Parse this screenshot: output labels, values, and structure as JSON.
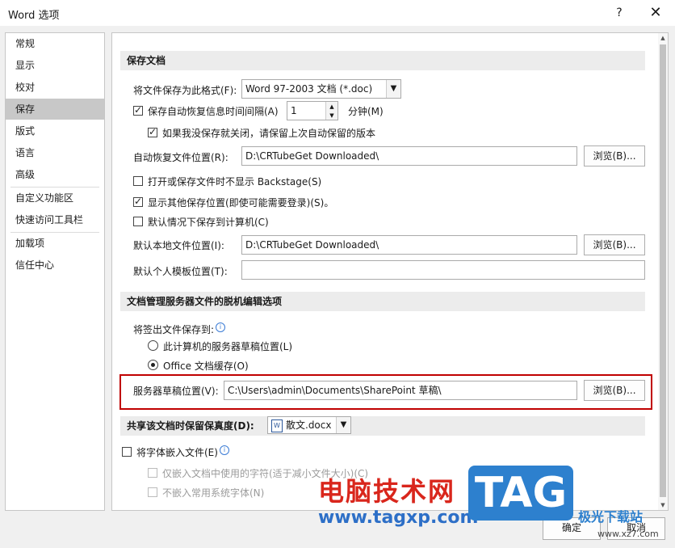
{
  "window": {
    "title": "Word 选项",
    "help": "?",
    "close": "✕"
  },
  "nav": {
    "items": [
      {
        "label": "常规"
      },
      {
        "label": "显示"
      },
      {
        "label": "校对"
      },
      {
        "label": "保存"
      },
      {
        "label": "版式"
      },
      {
        "label": "语言"
      },
      {
        "label": "高级"
      },
      {
        "label": "自定义功能区"
      },
      {
        "label": "快速访问工具栏"
      },
      {
        "label": "加载项"
      },
      {
        "label": "信任中心"
      }
    ],
    "selected": "保存"
  },
  "save_docs": {
    "header": "保存文档",
    "format_label": "将文件保存为此格式(F):",
    "format_value": "Word 97-2003 文档 (*.doc)",
    "autorecover_label": "保存自动恢复信息时间间隔(A)",
    "autorecover_value": "1",
    "minutes_label": "分钟(M)",
    "keep_last_label": "如果我没保存就关闭，请保留上次自动保留的版本",
    "autorecover_path_label": "自动恢复文件位置(R):",
    "autorecover_path": "D:\\CRTubeGet Downloaded\\",
    "browse1": "浏览(B)...",
    "no_backstage_label": "打开或保存文件时不显示 Backstage(S)",
    "show_other_label": "显示其他保存位置(即使可能需要登录)(S)。",
    "default_computer_label": "默认情况下保存到计算机(C)",
    "default_local_label": "默认本地文件位置(I):",
    "default_local_path": "D:\\CRTubeGet Downloaded\\",
    "browse2": "浏览(B)...",
    "template_label": "默认个人模板位置(T):",
    "template_path": ""
  },
  "offline": {
    "header": "文档管理服务器文件的脱机编辑选项",
    "checkout_label": "将签出文件保存到:",
    "radio1": "此计算机的服务器草稿位置(L)",
    "radio2": "Office 文档缓存(O)",
    "drafts_label": "服务器草稿位置(V):",
    "drafts_path": "C:\\Users\\admin\\Documents\\SharePoint 草稿\\",
    "browse3": "浏览(B)..."
  },
  "fidelity": {
    "header": "共享该文档时保留保真度(D):",
    "doc_value": "散文.docx",
    "embed_fonts": "将字体嵌入文件(E)",
    "embed_used_only": "仅嵌入文档中使用的字符(适于减小文件大小)(C)",
    "no_common_fonts": "不嵌入常用系统字体(N)"
  },
  "footer": {
    "ok": "确定",
    "cancel": "取消"
  },
  "watermark": {
    "cn_text": "电脑技术网",
    "url": "www.tagxp.com",
    "tag": "TAG",
    "site_name": "极光下载站",
    "site_url": "www.xz7.com"
  }
}
